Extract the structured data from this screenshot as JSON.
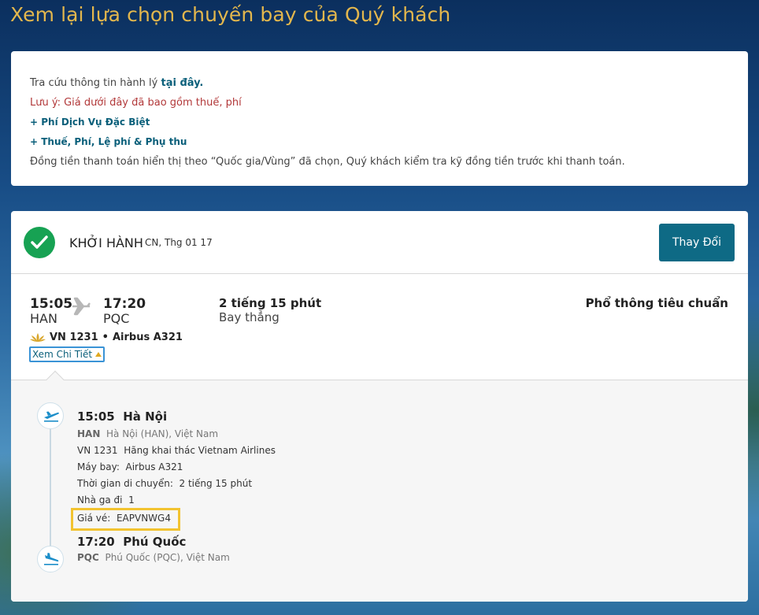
{
  "page_title": "Xem lại lựa chọn chuyến bay của Quý khách",
  "info": {
    "baggage_prefix": "Tra cứu thông tin hành lý",
    "baggage_link": "tại đây.",
    "note": "Lưu ý: Giá dưới đây đã bao gồm thuế, phí",
    "special_fee": "+ Phí Dịch Vụ Đặc Biệt",
    "tax_fee": "+ Thuế, Phí, Lệ phí & Phụ thu",
    "currency_note": "Đồng tiền thanh toán hiển thị theo “Quốc gia/Vùng” đã chọn, Quý khách kiểm tra kỹ đồng tiền trước khi thanh toán."
  },
  "flight": {
    "direction": "KHỞI HÀNH",
    "date": "CN, Thg 01 17",
    "change_label": "Thay Đổi",
    "depart_time": "15:05",
    "depart_code": "HAN",
    "arrive_time": "17:20",
    "arrive_code": "PQC",
    "duration": "2 tiếng 15 phút",
    "stops": "Bay thẳng",
    "cabin": "Phổ thông tiêu chuẩn",
    "flight_number": "VN 1231",
    "aircraft": "Airbus A321",
    "details_label": "Xem Chi Tiết"
  },
  "detail": {
    "origin_time": "15:05",
    "origin_city": "Hà Nội",
    "origin_code": "HAN",
    "origin_full": "Hà Nội (HAN), Việt Nam",
    "flight_no": "VN 1231",
    "operator": "Hãng khai thác Vietnam Airlines",
    "aircraft_label": "Máy bay:",
    "aircraft": "Airbus A321",
    "travel_time_label": "Thời gian di chuyển:",
    "travel_time": "2 tiếng 15 phút",
    "terminal_label": "Nhà ga đi",
    "terminal": "1",
    "fare_label": "Giá vé:",
    "fare_code": "EAPVNWG4",
    "dest_time": "17:20",
    "dest_city": "Phú Quốc",
    "dest_code": "PQC",
    "dest_full": "Phú Quốc (PQC), Việt Nam"
  },
  "colors": {
    "accent": "#0e6a85",
    "title_gold": "#e3b74d",
    "success": "#17a253",
    "highlight": "#f2c330"
  },
  "icons": [
    "check-icon",
    "airplane-icon",
    "lotus-logo-icon",
    "caret-up-icon",
    "takeoff-icon",
    "landing-icon"
  ]
}
